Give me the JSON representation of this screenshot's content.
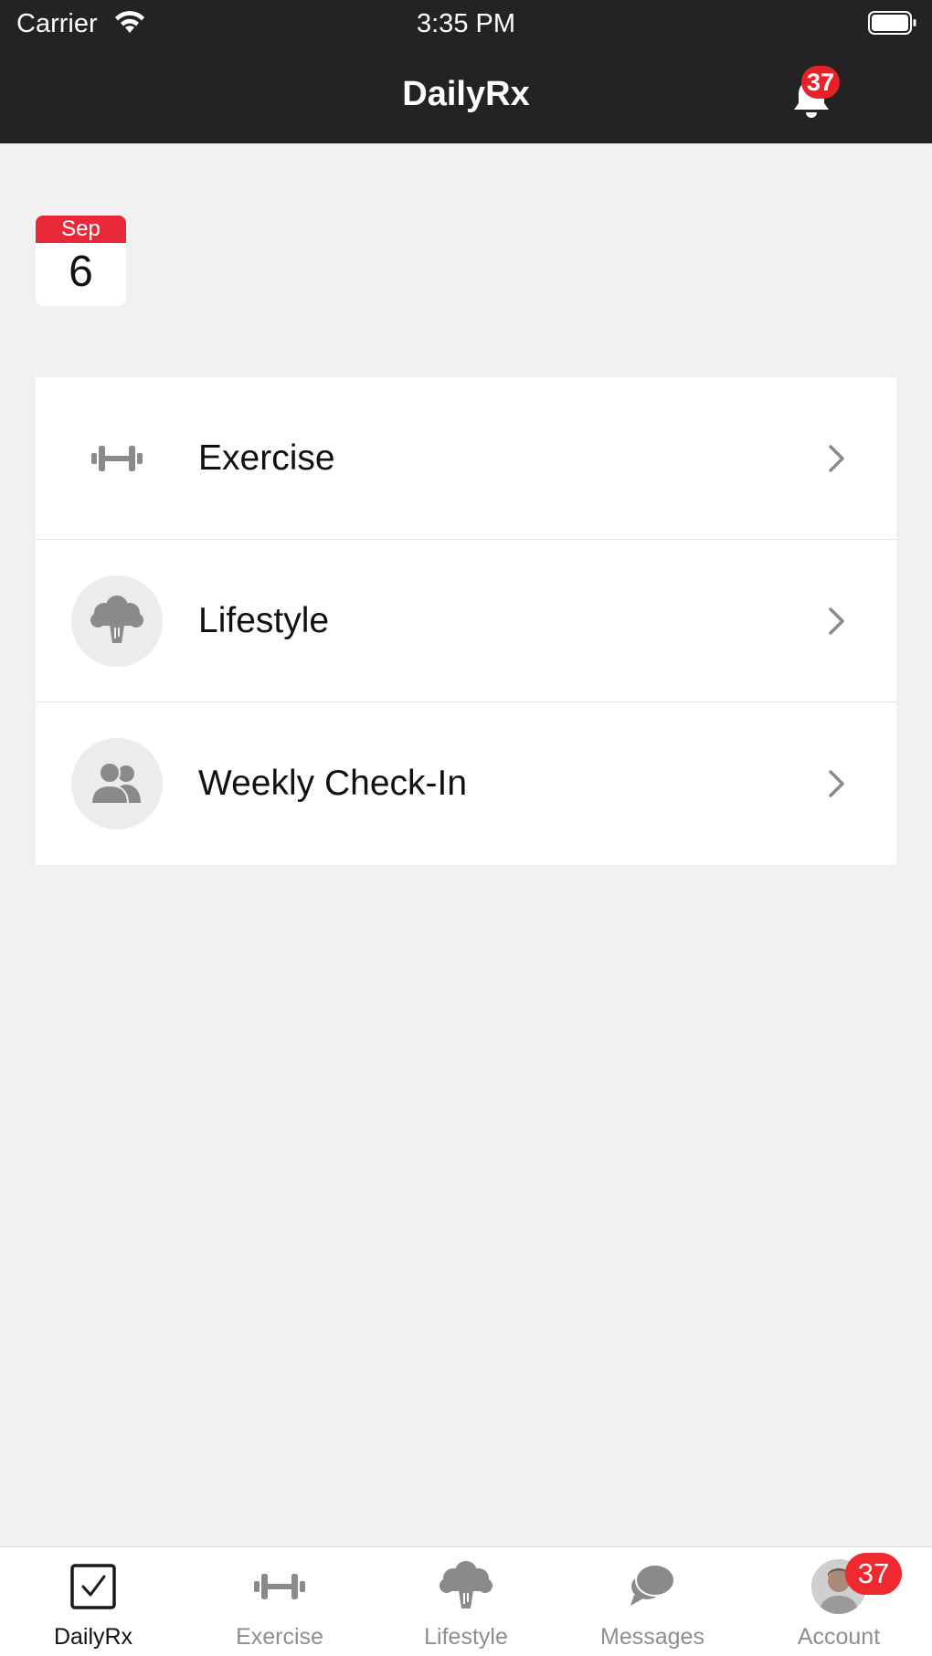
{
  "status_bar": {
    "carrier": "Carrier",
    "time": "3:35 PM"
  },
  "nav": {
    "title": "DailyRx",
    "notification_count": "37",
    "bell_icon": "bell-icon"
  },
  "date_tile": {
    "month": "Sep",
    "day": "6"
  },
  "list": {
    "items": [
      {
        "label": "Exercise",
        "icon": "dumbbell-icon"
      },
      {
        "label": "Lifestyle",
        "icon": "broccoli-icon"
      },
      {
        "label": "Weekly Check-In",
        "icon": "people-icon"
      }
    ]
  },
  "tabbar": {
    "tabs": [
      {
        "label": "DailyRx",
        "icon": "checkbox-icon",
        "active": true
      },
      {
        "label": "Exercise",
        "icon": "dumbbell-icon"
      },
      {
        "label": "Lifestyle",
        "icon": "broccoli-icon"
      },
      {
        "label": "Messages",
        "icon": "chat-bubbles-icon"
      },
      {
        "label": "Account",
        "icon": "avatar-icon"
      }
    ],
    "account_badge": "37"
  },
  "colors": {
    "bar": "#232323",
    "accent_red": "#e9283a",
    "icon_gray": "#8a8a8a",
    "background": "#f1f1f1"
  }
}
